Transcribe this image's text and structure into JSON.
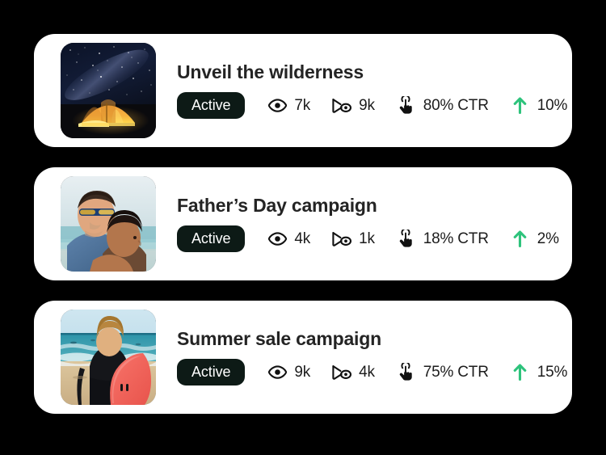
{
  "page": {
    "background_color": "#000000",
    "card_background": "#ffffff",
    "badge_background": "#0d1a16",
    "badge_text_color": "#ffffff",
    "title_color": "#242424",
    "metric_text_color": "#1c1c1c",
    "delta_arrow_color": "#2ec37c"
  },
  "cards": [
    {
      "title": "Unveil the wilderness",
      "status": "Active",
      "thumbnail": "night-camping-tent-under-milky-way-photo",
      "metrics": [
        {
          "icon": "eye-icon",
          "value": "7k"
        },
        {
          "icon": "video-views-icon",
          "value": "9k"
        },
        {
          "icon": "click-hand-icon",
          "value": "80% CTR"
        },
        {
          "icon": "arrow-up-icon",
          "value": "10%"
        }
      ]
    },
    {
      "title": "Father’s Day campaign",
      "status": "Active",
      "thumbnail": "father-and-son-at-beach-photo",
      "metrics": [
        {
          "icon": "eye-icon",
          "value": "4k"
        },
        {
          "icon": "video-views-icon",
          "value": "1k"
        },
        {
          "icon": "click-hand-icon",
          "value": "18% CTR"
        },
        {
          "icon": "arrow-up-icon",
          "value": "2%"
        }
      ]
    },
    {
      "title": "Summer sale campaign",
      "status": "Active",
      "thumbnail": "surfer-with-red-surfboard-on-beach-photo",
      "metrics": [
        {
          "icon": "eye-icon",
          "value": "9k"
        },
        {
          "icon": "video-views-icon",
          "value": "4k"
        },
        {
          "icon": "click-hand-icon",
          "value": "75% CTR"
        },
        {
          "icon": "arrow-up-icon",
          "value": "15%"
        }
      ]
    }
  ]
}
